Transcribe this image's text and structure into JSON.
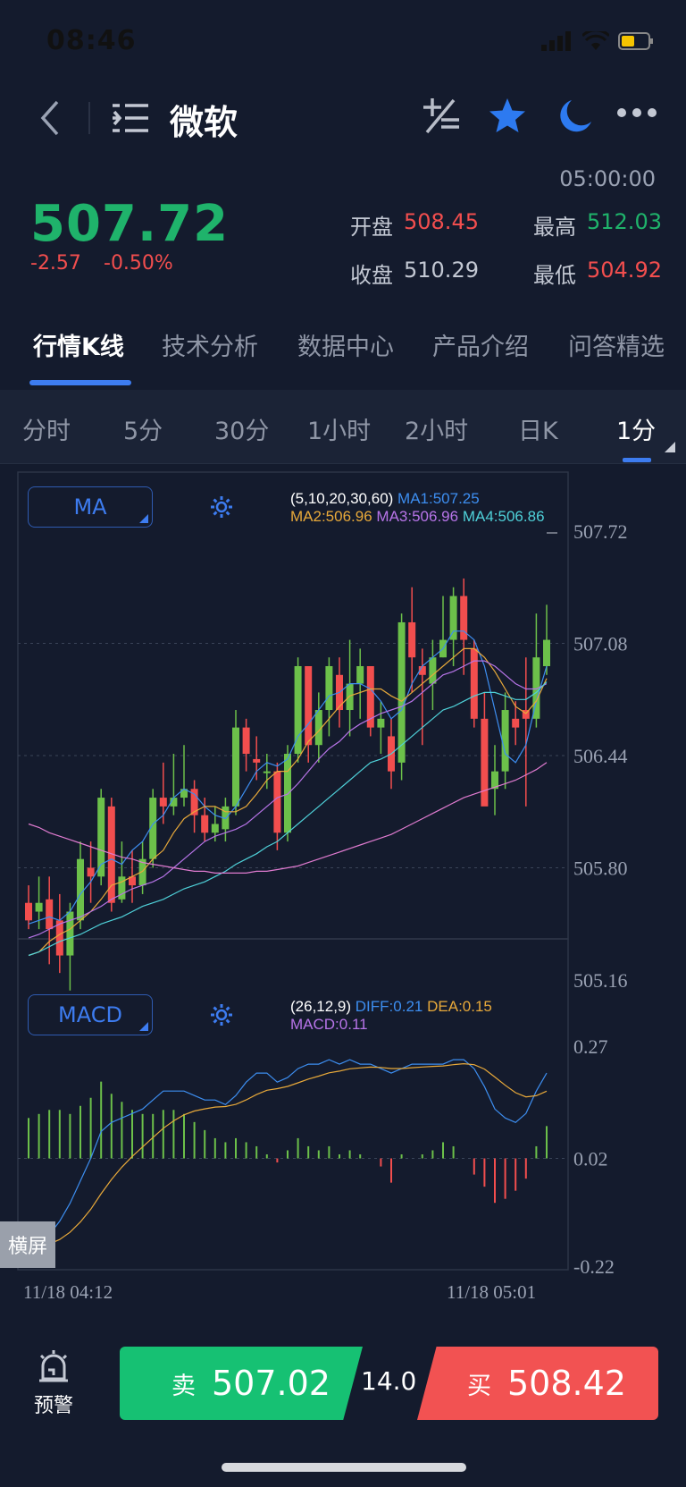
{
  "status_bar": {
    "time": "08:46"
  },
  "nav": {
    "title": "微软"
  },
  "quote": {
    "timestamp": "05:00:00",
    "last": "507.72",
    "change": "-2.57",
    "change_pct": "-0.50%",
    "open_label": "开盘",
    "open": "508.45",
    "high_label": "最高",
    "high": "512.03",
    "close_label": "收盘",
    "close": "510.29",
    "low_label": "最低",
    "low": "504.92"
  },
  "tabs": [
    "行情K线",
    "技术分析",
    "数据中心",
    "产品介绍",
    "问答精选"
  ],
  "periods": [
    "分时",
    "5分",
    "30分",
    "1小时",
    "2小时",
    "日K",
    "1分"
  ],
  "main_indicator": {
    "button": "MA",
    "params": "(5,10,20,30,60)",
    "ma1": "MA1:507.25",
    "ma2": "MA2:506.96",
    "ma3": "MA3:506.96",
    "ma4": "MA4:506.86"
  },
  "sub_indicator": {
    "button": "MACD",
    "params": "(26,12,9)",
    "diff": "DIFF:0.21",
    "dea": "DEA:0.15",
    "macd": "MACD:0.11"
  },
  "landscape_label": "横屏",
  "colors": {
    "up": "#6cc04a",
    "down": "#f24e4e",
    "accent": "#3d7cf0",
    "ma1": "#3d8ef0",
    "ma2": "#e8a93a",
    "ma3": "#b774e8",
    "ma4": "#4fd1d9",
    "ma5": "#e07bd0"
  },
  "chart_data": {
    "type": "candlestick",
    "y_ticks": [
      "507.72",
      "507.08",
      "506.44",
      "505.80",
      "505.16"
    ],
    "ylim": [
      505.16,
      507.72
    ],
    "macd_ticks": [
      "0.27",
      "0.02",
      "-0.22"
    ],
    "macd_ylim": [
      -0.22,
      0.27
    ],
    "x_labels": [
      "11/18 04:12",
      "11/18 05:01"
    ],
    "candles": [
      [
        505.6,
        505.5,
        505.7,
        505.45
      ],
      [
        505.55,
        505.6,
        505.75,
        505.45
      ],
      [
        505.62,
        505.45,
        505.75,
        505.25
      ],
      [
        505.5,
        505.3,
        505.65,
        505.2
      ],
      [
        505.3,
        505.55,
        505.6,
        505.1
      ],
      [
        505.5,
        505.85,
        505.95,
        505.45
      ],
      [
        505.8,
        505.75,
        505.95,
        505.6
      ],
      [
        505.75,
        506.2,
        506.25,
        505.7
      ],
      [
        506.15,
        505.6,
        506.2,
        505.55
      ],
      [
        505.62,
        505.75,
        505.95,
        505.6
      ],
      [
        505.75,
        505.7,
        505.9,
        505.6
      ],
      [
        505.7,
        505.85,
        505.95,
        505.65
      ],
      [
        505.85,
        506.2,
        506.25,
        505.8
      ],
      [
        506.2,
        506.15,
        506.4,
        506.05
      ],
      [
        506.15,
        506.2,
        506.45,
        506.1
      ],
      [
        506.2,
        506.25,
        506.5,
        506.15
      ],
      [
        506.25,
        506.1,
        506.3,
        506.0
      ],
      [
        506.1,
        506.0,
        506.2,
        505.95
      ],
      [
        506.0,
        506.05,
        506.15,
        505.95
      ],
      [
        506.02,
        506.15,
        506.2,
        505.95
      ],
      [
        506.15,
        506.6,
        506.7,
        506.1
      ],
      [
        506.6,
        506.45,
        506.65,
        506.35
      ],
      [
        506.42,
        506.4,
        506.55,
        506.3
      ],
      [
        506.35,
        506.35,
        506.45,
        506.25
      ],
      [
        506.35,
        506.0,
        506.4,
        505.9
      ],
      [
        506.0,
        506.45,
        506.5,
        505.95
      ],
      [
        506.45,
        506.95,
        507.0,
        506.4
      ],
      [
        506.95,
        506.5,
        506.95,
        506.4
      ],
      [
        506.5,
        506.7,
        506.8,
        506.4
      ],
      [
        506.7,
        506.95,
        507.0,
        506.55
      ],
      [
        506.9,
        506.7,
        507.0,
        506.6
      ],
      [
        506.7,
        506.85,
        507.1,
        506.55
      ],
      [
        506.85,
        506.95,
        507.05,
        506.65
      ],
      [
        506.95,
        506.6,
        506.95,
        506.55
      ],
      [
        506.6,
        506.65,
        506.75,
        506.45
      ],
      [
        506.55,
        506.35,
        506.65,
        506.25
      ],
      [
        506.4,
        507.2,
        507.25,
        506.3
      ],
      [
        507.2,
        507.0,
        507.4,
        506.8
      ],
      [
        506.95,
        506.9,
        507.05,
        506.5
      ],
      [
        506.85,
        507.0,
        507.1,
        506.7
      ],
      [
        507.0,
        507.1,
        507.35,
        507.0
      ],
      [
        507.1,
        507.35,
        507.4,
        506.95
      ],
      [
        507.35,
        507.1,
        507.45,
        506.9
      ],
      [
        507.05,
        506.65,
        507.1,
        506.6
      ],
      [
        506.65,
        506.15,
        506.8,
        506.2
      ],
      [
        506.25,
        506.35,
        506.5,
        506.1
      ],
      [
        506.35,
        506.7,
        506.8,
        506.25
      ],
      [
        506.65,
        506.6,
        506.75,
        506.5
      ],
      [
        506.7,
        506.65,
        507.0,
        506.15
      ],
      [
        506.65,
        507.0,
        507.25,
        506.6
      ],
      [
        506.95,
        507.1,
        507.3,
        506.9
      ]
    ],
    "series": [
      {
        "name": "MA1",
        "values": [
          505.48,
          505.5,
          505.52,
          505.5,
          505.55,
          505.65,
          505.72,
          505.82,
          505.85,
          505.82,
          505.9,
          505.95,
          506.05,
          506.1,
          506.2,
          506.25,
          506.22,
          506.15,
          506.1,
          506.08,
          506.15,
          506.25,
          506.35,
          506.4,
          506.38,
          506.42,
          506.55,
          506.62,
          506.7,
          506.78,
          506.8,
          506.85,
          506.85,
          506.82,
          506.75,
          506.65,
          506.7,
          506.85,
          506.95,
          507.0,
          507.05,
          507.15,
          507.15,
          507.1,
          506.95,
          506.7,
          506.45,
          506.4,
          506.5,
          506.75,
          506.95
        ]
      },
      {
        "name": "MA2",
        "values": [
          505.3,
          505.32,
          505.38,
          505.42,
          505.45,
          505.5,
          505.55,
          505.62,
          505.7,
          505.72,
          505.75,
          505.78,
          505.85,
          505.9,
          506.0,
          506.08,
          506.12,
          506.15,
          506.15,
          506.12,
          506.12,
          506.15,
          506.22,
          506.3,
          506.35,
          506.35,
          506.42,
          506.52,
          506.58,
          506.65,
          506.72,
          506.78,
          506.8,
          506.82,
          506.82,
          506.78,
          506.75,
          506.8,
          506.85,
          506.9,
          506.95,
          507.0,
          507.05,
          507.05,
          507.0,
          506.92,
          506.82,
          506.72,
          506.68,
          506.75,
          506.88
        ]
      },
      {
        "name": "MA3",
        "values": [
          505.4,
          505.42,
          505.45,
          505.48,
          505.5,
          505.52,
          505.55,
          505.58,
          505.62,
          505.65,
          505.68,
          505.7,
          505.72,
          505.75,
          505.8,
          505.85,
          505.9,
          505.95,
          505.98,
          506.0,
          506.02,
          506.05,
          506.1,
          506.15,
          506.2,
          506.22,
          506.28,
          506.35,
          506.42,
          506.48,
          506.52,
          506.58,
          506.62,
          506.65,
          506.68,
          506.7,
          506.72,
          506.75,
          506.8,
          506.85,
          506.9,
          506.92,
          506.95,
          506.98,
          506.98,
          506.95,
          506.9,
          506.85,
          506.82,
          506.82,
          506.85
        ]
      },
      {
        "name": "MA4",
        "values": [
          505.3,
          505.32,
          505.35,
          505.38,
          505.4,
          505.42,
          505.45,
          505.48,
          505.5,
          505.52,
          505.55,
          505.58,
          505.6,
          505.62,
          505.65,
          505.68,
          505.7,
          505.72,
          505.75,
          505.78,
          505.82,
          505.85,
          505.88,
          505.92,
          505.95,
          506.0,
          506.05,
          506.1,
          506.15,
          506.2,
          506.25,
          506.3,
          506.35,
          506.4,
          506.42,
          506.45,
          506.5,
          506.55,
          506.6,
          506.65,
          506.7,
          506.72,
          506.75,
          506.78,
          506.8,
          506.8,
          506.78,
          506.76,
          506.76,
          506.8,
          506.86
        ]
      },
      {
        "name": "MA5",
        "values": [
          506.05,
          506.03,
          506.0,
          505.98,
          505.96,
          505.94,
          505.92,
          505.9,
          505.88,
          505.86,
          505.85,
          505.83,
          505.82,
          505.81,
          505.8,
          505.79,
          505.78,
          505.78,
          505.77,
          505.77,
          505.77,
          505.77,
          505.78,
          505.78,
          505.79,
          505.8,
          505.81,
          505.83,
          505.85,
          505.87,
          505.89,
          505.91,
          505.93,
          505.95,
          505.97,
          505.99,
          506.02,
          506.05,
          506.08,
          506.11,
          506.14,
          506.17,
          506.2,
          506.22,
          506.24,
          506.26,
          506.28,
          506.3,
          506.33,
          506.36,
          506.4
        ]
      }
    ],
    "macd_hist": [
      0.1,
      0.11,
      0.12,
      0.12,
      0.11,
      0.13,
      0.15,
      0.19,
      0.16,
      0.14,
      0.12,
      0.11,
      0.11,
      0.12,
      0.12,
      0.11,
      0.09,
      0.07,
      0.05,
      0.04,
      0.05,
      0.04,
      0.03,
      0.01,
      -0.01,
      0.02,
      0.05,
      0.03,
      0.02,
      0.03,
      0.01,
      0.02,
      0.01,
      0.0,
      -0.02,
      -0.06,
      0.01,
      0.0,
      0.01,
      0.02,
      0.04,
      0.03,
      0.0,
      -0.04,
      -0.07,
      -0.11,
      -0.1,
      -0.08,
      -0.05,
      0.03,
      0.08
    ],
    "diff": [
      -0.18,
      -0.16,
      -0.15,
      -0.12,
      -0.08,
      -0.03,
      0.02,
      0.08,
      0.1,
      0.11,
      0.12,
      0.13,
      0.15,
      0.17,
      0.17,
      0.17,
      0.16,
      0.15,
      0.15,
      0.14,
      0.16,
      0.19,
      0.21,
      0.21,
      0.19,
      0.2,
      0.22,
      0.23,
      0.23,
      0.24,
      0.23,
      0.24,
      0.23,
      0.23,
      0.22,
      0.21,
      0.22,
      0.23,
      0.23,
      0.23,
      0.23,
      0.24,
      0.24,
      0.22,
      0.18,
      0.13,
      0.11,
      0.1,
      0.12,
      0.17,
      0.21
    ]
  }
}
